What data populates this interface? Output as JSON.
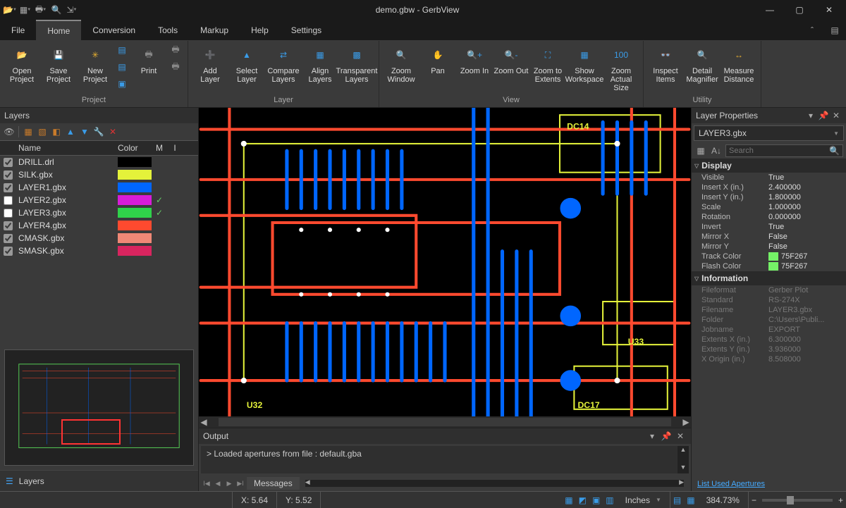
{
  "app": {
    "title": "demo.gbw - GerbView"
  },
  "menus": [
    "File",
    "Home",
    "Conversion",
    "Tools",
    "Markup",
    "Help",
    "Settings"
  ],
  "menus_active_index": 1,
  "ribbon": {
    "project": {
      "label": "Project",
      "open": "Open Project",
      "save": "Save Project",
      "new": "New Project",
      "print": "Print"
    },
    "layer": {
      "label": "Layer",
      "add": "Add Layer",
      "select": "Select Layer",
      "compare": "Compare Layers",
      "align": "Align Layers",
      "transparent": "Transparent Layers"
    },
    "view": {
      "label": "View",
      "zoomw": "Zoom Window",
      "pan": "Pan",
      "zin": "Zoom In",
      "zout": "Zoom Out",
      "zext": "Zoom to Extents",
      "showws": "Show Workspace",
      "zactual": "Zoom Actual Size"
    },
    "utility": {
      "label": "Utility",
      "inspect": "Inspect Items",
      "magnifier": "Detail Magnifier",
      "measure": "Measure Distance"
    }
  },
  "layers_panel": {
    "title": "Layers",
    "columns": {
      "name": "Name",
      "color": "Color",
      "m": "M",
      "i": "I"
    },
    "segment": "Layers",
    "rows": [
      {
        "checked": true,
        "name": "DRILL.drl",
        "color": "#000000",
        "m": false
      },
      {
        "checked": true,
        "name": "SILK.gbx",
        "color": "#e4f23a",
        "m": false
      },
      {
        "checked": true,
        "name": "LAYER1.gbx",
        "color": "#0066ff",
        "m": false
      },
      {
        "checked": false,
        "name": "LAYER2.gbx",
        "color": "#d81cd8",
        "m": true
      },
      {
        "checked": false,
        "name": "LAYER3.gbx",
        "color": "#2fd24a",
        "m": true
      },
      {
        "checked": true,
        "name": "LAYER4.gbx",
        "color": "#ff4a2f",
        "m": false
      },
      {
        "checked": true,
        "name": "CMASK.gbx",
        "color": "#f08876",
        "m": false
      },
      {
        "checked": true,
        "name": "SMASK.gbx",
        "color": "#d8255f",
        "m": false
      }
    ]
  },
  "properties": {
    "title": "Layer Properties",
    "layer": "LAYER3.gbx",
    "search_placeholder": "Search",
    "groups": {
      "display": {
        "title": "Display",
        "rows": [
          {
            "k": "Visible",
            "v": "True"
          },
          {
            "k": "Insert X (in.)",
            "v": "2.400000"
          },
          {
            "k": "Insert Y (in.)",
            "v": "1.800000"
          },
          {
            "k": "Scale",
            "v": "1.000000"
          },
          {
            "k": "Rotation",
            "v": "0.000000"
          },
          {
            "k": "Invert",
            "v": "True"
          },
          {
            "k": "Mirror X",
            "v": "False"
          },
          {
            "k": "Mirror Y",
            "v": "False"
          },
          {
            "k": "Track Color",
            "v": "75F267",
            "sw": "#75F267"
          },
          {
            "k": "Flash Color",
            "v": "75F267",
            "sw": "#75F267"
          }
        ]
      },
      "info": {
        "title": "Information",
        "rows": [
          {
            "k": "Fileformat",
            "v": "Gerber Plot"
          },
          {
            "k": "Standard",
            "v": "RS-274X"
          },
          {
            "k": "Filename",
            "v": "LAYER3.gbx"
          },
          {
            "k": "Folder",
            "v": "C:\\Users\\Publi..."
          },
          {
            "k": "Jobname",
            "v": "EXPORT"
          },
          {
            "k": "Extents X (in.)",
            "v": "6.300000"
          },
          {
            "k": "Extents Y (in.)",
            "v": "3.936000"
          },
          {
            "k": "X Origin (in.)",
            "v": "8.508000"
          }
        ]
      }
    },
    "link": "List Used Apertures"
  },
  "output": {
    "title": "Output",
    "line": "> Loaded apertures from file : default.gba",
    "tab": "Messages"
  },
  "status": {
    "x": "X: 5.64",
    "y": "Y: 5.52",
    "units": "Inches",
    "zoom": "384.73%"
  },
  "canvas_labels": {
    "u32": "U32",
    "dc14": "DC14",
    "dc17": "DC17",
    "u33": "U33"
  }
}
